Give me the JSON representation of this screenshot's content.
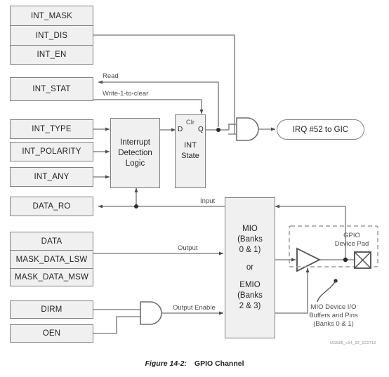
{
  "figure": {
    "number": "Figure 14-2:",
    "title": "GPIO Channel",
    "watermark": "UG585_c14_02_022712"
  },
  "registers": {
    "int_mask": "INT_MASK",
    "int_dis": "INT_DIS",
    "int_en": "INT_EN",
    "int_stat": "INT_STAT",
    "int_type": "INT_TYPE",
    "int_polarity": "INT_POLARITY",
    "int_any": "INT_ANY",
    "data_ro": "DATA_RO",
    "data": "DATA",
    "mask_data_lsw": "MASK_DATA_LSW",
    "mask_data_msw": "MASK_DATA_MSW",
    "dirm": "DIRM",
    "oen": "OEN"
  },
  "blocks": {
    "idl_line1": "Interrupt",
    "idl_line2": "Detection",
    "idl_line3": "Logic",
    "ff_clr": "Clr",
    "ff_d": "D",
    "ff_q": "Q",
    "ff_name_line1": "INT",
    "ff_name_line2": "State",
    "mio_line1": "MIO",
    "mio_line2": "(Banks",
    "mio_line3": "0 & 1)",
    "mio_line4": "or",
    "mio_line5": "EMIO",
    "mio_line6": "(Banks",
    "mio_line7": "2 & 3)",
    "irq": "IRQ #52 to GIC"
  },
  "signals": {
    "read": "Read",
    "write_1_to_clear": "Write-1-to-clear",
    "input": "Input",
    "output": "Output",
    "output_enable": "Output Enable"
  },
  "annotations": {
    "pad_line1": "GPIO",
    "pad_line2": "Device Pad",
    "note_line1": "MIO Device I/O",
    "note_line2": "Buffers and Pins",
    "note_line3": "(Banks 0 & 1)"
  },
  "colors": {
    "fill": "#f0f0f0",
    "stroke": "#808080",
    "wire": "#6e6e6e",
    "text": "#231f20"
  }
}
